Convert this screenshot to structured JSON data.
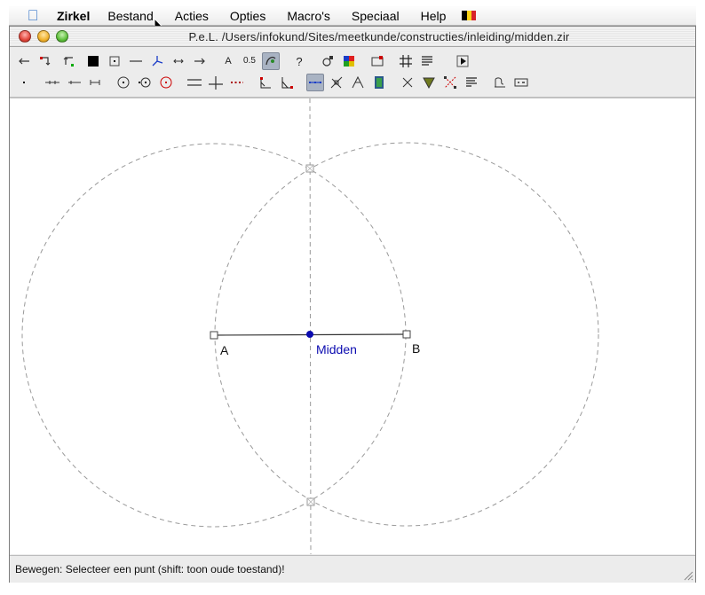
{
  "menubar": {
    "app_name": "Zirkel",
    "items": [
      "Bestand",
      "Acties",
      "Opties",
      "Macro's",
      "Speciaal",
      "Help"
    ],
    "flag_colors": [
      "#000000",
      "#f7d117",
      "#d8232a"
    ]
  },
  "window": {
    "title": "P.e.L.  /Users/infokund/Sites/meetkunde/constructies/inleiding/midden.zir"
  },
  "toolbar": {
    "label_text_tool": "A",
    "label_decimals_tool": "0.5",
    "label_help_tool": "?",
    "active_tools": [
      "toggle-tool",
      "midpoint-tool"
    ]
  },
  "canvas": {
    "point_a_label": "A",
    "point_b_label": "B",
    "midpoint_label": "Midden",
    "midpoint_color": "#0b0bb0",
    "construction_color": "#9a9a9a",
    "segment_color": "#333333"
  },
  "statusbar": {
    "message": "Bewegen: Selecteer een punt (shift: toon oude toestand)!"
  }
}
